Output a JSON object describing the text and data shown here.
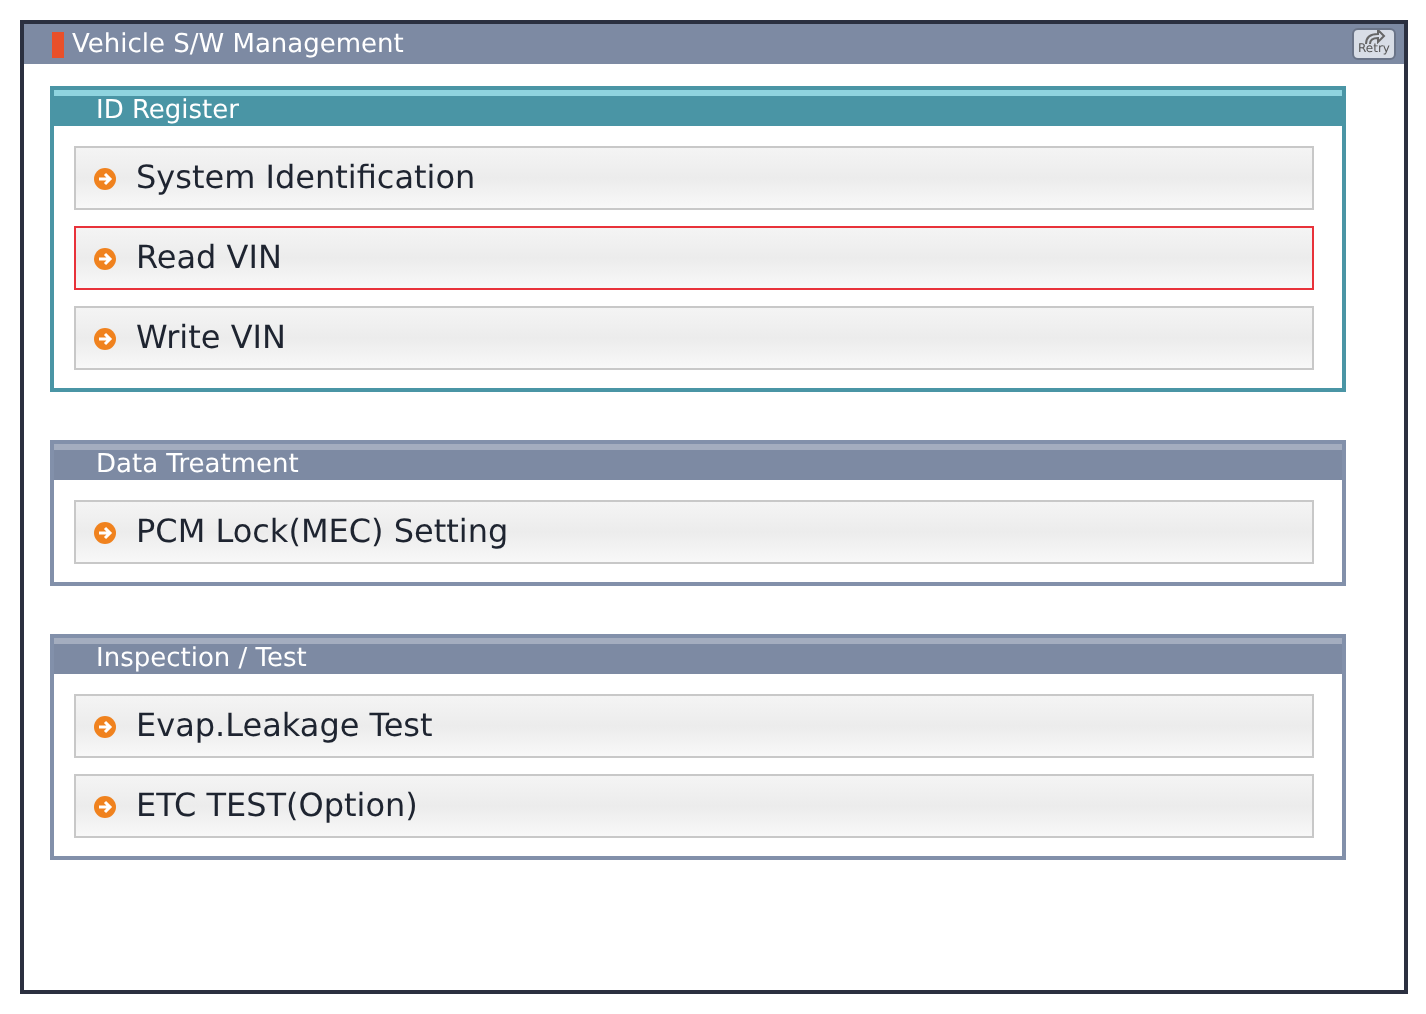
{
  "window": {
    "title": "Vehicle S/W Management",
    "retry_button": "Retry"
  },
  "groups": [
    {
      "title": "ID Register",
      "active": true,
      "items": [
        {
          "label": "System Identification",
          "selected": false
        },
        {
          "label": "Read VIN",
          "selected": true
        },
        {
          "label": "Write VIN",
          "selected": false
        }
      ]
    },
    {
      "title": "Data Treatment",
      "active": false,
      "items": [
        {
          "label": "PCM Lock(MEC) Setting",
          "selected": false
        }
      ]
    },
    {
      "title": "Inspection / Test",
      "active": false,
      "items": [
        {
          "label": "Evap.Leakage Test",
          "selected": false
        },
        {
          "label": "ETC TEST(Option)",
          "selected": false
        }
      ]
    }
  ]
}
